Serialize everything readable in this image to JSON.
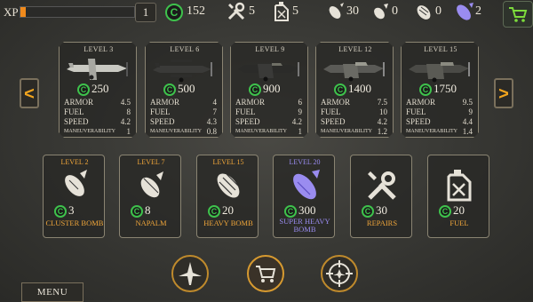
{
  "topbar": {
    "xp_label": "XP",
    "xp_progress": 0.05,
    "level": "1",
    "coins": "152",
    "repairs": "5",
    "fuel": "5",
    "cluster_bombs": "30",
    "napalm": "0",
    "heavy_bombs": "0",
    "super_heavy_bombs": "2",
    "coin_symbol": "C"
  },
  "nav": {
    "left_arrow": "<",
    "right_arrow": ">"
  },
  "planes": [
    {
      "level": "LEVEL 3",
      "price": "250",
      "armor": "4.5",
      "fuel": "8",
      "speed": "4.2",
      "maneuverability": "1"
    },
    {
      "level": "LEVEL 6",
      "price": "500",
      "armor": "4",
      "fuel": "7",
      "speed": "4.3",
      "maneuverability": "0.8"
    },
    {
      "level": "LEVEL 9",
      "price": "900",
      "armor": "6",
      "fuel": "9",
      "speed": "4.2",
      "maneuverability": "1"
    },
    {
      "level": "LEVEL 12",
      "price": "1400",
      "armor": "7.5",
      "fuel": "10",
      "speed": "4.2",
      "maneuverability": "1.2"
    },
    {
      "level": "LEVEL 15",
      "price": "1750",
      "armor": "9.5",
      "fuel": "9",
      "speed": "4.4",
      "maneuverability": "1.4"
    }
  ],
  "stat_labels": {
    "armor": "ARMOR",
    "fuel": "FUEL",
    "speed": "SPEED",
    "maneuverability": "MANEUVERABILITY"
  },
  "items": [
    {
      "level": "LEVEL 2",
      "price": "3",
      "name": "CLUSTER BOMB",
      "icon": "cluster-bomb-icon"
    },
    {
      "level": "LEVEL 7",
      "price": "8",
      "name": "NAPALM",
      "icon": "napalm-icon"
    },
    {
      "level": "LEVEL 15",
      "price": "20",
      "name": "HEAVY BOMB",
      "icon": "heavy-bomb-icon"
    },
    {
      "level": "LEVEL 20",
      "price": "300",
      "name": "SUPER HEAVY BOMB",
      "icon": "super-heavy-bomb-icon"
    },
    {
      "level": "",
      "price": "30",
      "name": "REPAIRS",
      "icon": "repairs-icon"
    },
    {
      "level": "",
      "price": "20",
      "name": "FUEL",
      "icon": "fuel-icon"
    }
  ],
  "bottom": {
    "menu_label": "MENU"
  },
  "colors": {
    "accent": "#f0a63a",
    "coin": "#3ec24c",
    "cart": "#7ddb3c",
    "xp": "#f08a1c",
    "super_heavy": "#9a8cf0"
  }
}
